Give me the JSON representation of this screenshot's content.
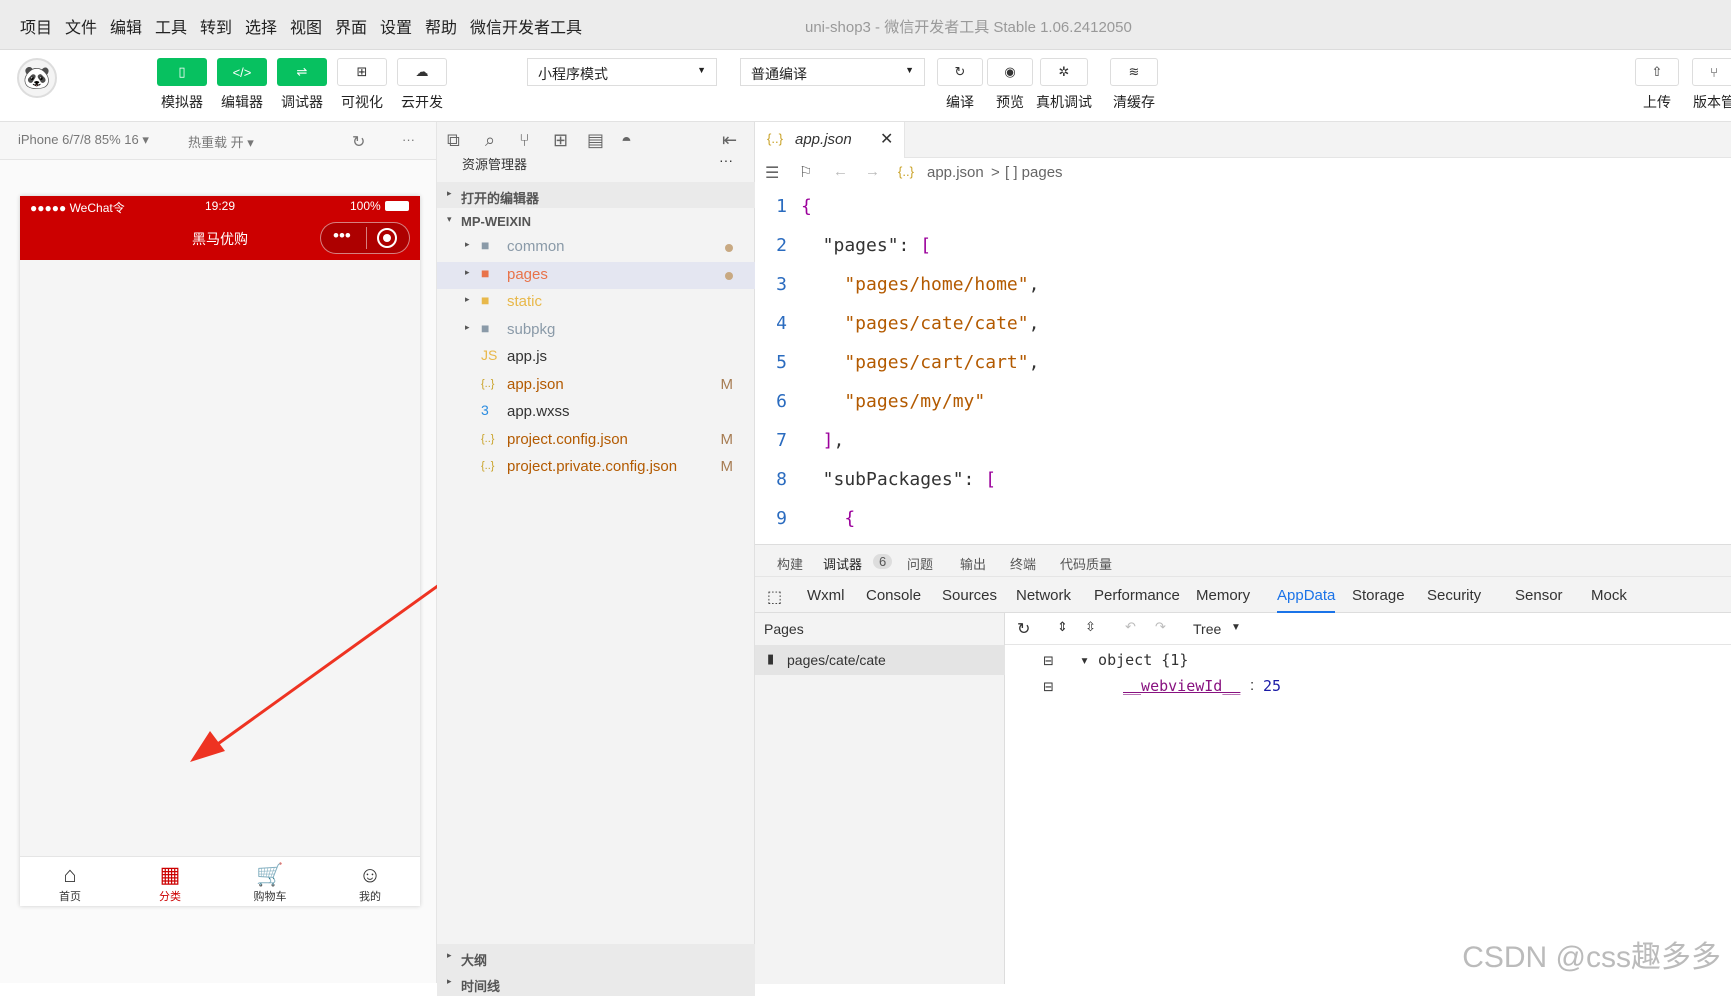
{
  "menubar": {
    "items": [
      "项目",
      "文件",
      "编辑",
      "工具",
      "转到",
      "选择",
      "视图",
      "界面",
      "设置",
      "帮助",
      "微信开发者工具"
    ],
    "title": "uni-shop3 - 微信开发者工具 Stable 1.06.2412050"
  },
  "toolbar": {
    "buttons": [
      {
        "label": "模拟器",
        "icon": "▯"
      },
      {
        "label": "编辑器",
        "icon": "</>"
      },
      {
        "label": "调试器",
        "icon": "⇌"
      },
      {
        "label": "可视化",
        "icon": "⊞"
      },
      {
        "label": "云开发",
        "icon": "☁"
      }
    ],
    "mode_select": "小程序模式",
    "compile_select": "普通编译",
    "actions": [
      {
        "label": "编译",
        "icon": "↻"
      },
      {
        "label": "预览",
        "icon": "◉"
      },
      {
        "label": "真机调试",
        "icon": "✲"
      },
      {
        "label": "清缓存",
        "icon": "≋"
      }
    ],
    "right": [
      {
        "label": "上传",
        "icon": "⇧"
      },
      {
        "label": "版本管",
        "icon": "⑂"
      }
    ]
  },
  "simulator": {
    "device": "iPhone 6/7/8 85% 16 ▾",
    "hotreload": "热重载 开 ▾",
    "status": {
      "carrier": "●●●●● WeChat令",
      "time": "19:29",
      "battery": "100%"
    },
    "nav_title": "黑马优购",
    "tabs": [
      {
        "label": "首页",
        "icon": "⌂"
      },
      {
        "label": "分类",
        "icon": "▦"
      },
      {
        "label": "购物车",
        "icon": "🛒"
      },
      {
        "label": "我的",
        "icon": "☺"
      }
    ],
    "active_tab": "分类"
  },
  "explorer": {
    "title": "资源管理器",
    "more": "···",
    "open_editors": "打开的编辑器",
    "project": "MP-WEIXIN",
    "items": [
      {
        "name": "common",
        "icon": "folder",
        "color": "#8a9aa8",
        "mark": "dot",
        "twisty": "▸"
      },
      {
        "name": "pages",
        "icon": "folder",
        "color": "#e8734a",
        "mark": "dot",
        "twisty": "▸"
      },
      {
        "name": "static",
        "icon": "folder",
        "color": "#e8b84a",
        "mark": "",
        "twisty": "▸"
      },
      {
        "name": "subpkg",
        "icon": "folder",
        "color": "#8a9aa8",
        "mark": "",
        "twisty": "▸"
      },
      {
        "name": "app.js",
        "icon": "js",
        "color": "#333",
        "mark": "",
        "twisty": ""
      },
      {
        "name": "app.json",
        "icon": "json",
        "color": "#b35a00",
        "mark": "M",
        "twisty": ""
      },
      {
        "name": "app.wxss",
        "icon": "css",
        "color": "#333",
        "mark": "",
        "twisty": ""
      },
      {
        "name": "project.config.json",
        "icon": "json",
        "color": "#b35a00",
        "mark": "M",
        "twisty": ""
      },
      {
        "name": "project.private.config.json",
        "icon": "json",
        "color": "#b35a00",
        "mark": "M",
        "twisty": ""
      }
    ],
    "outline": "大纲",
    "timeline": "时间线"
  },
  "editor": {
    "tab": "app.json",
    "crumb_file": "app.json",
    "crumb_sep": ">",
    "crumb_node": "[ ] pages",
    "lines": [
      {
        "n": "1",
        "parts": [
          [
            "b",
            "{"
          ]
        ]
      },
      {
        "n": "2",
        "parts": [
          [
            "k",
            "  \"pages\": "
          ],
          [
            "b",
            "["
          ]
        ]
      },
      {
        "n": "3",
        "parts": [
          [
            "s",
            "    \"pages/home/home\""
          ],
          [
            "k",
            ","
          ]
        ]
      },
      {
        "n": "4",
        "parts": [
          [
            "s",
            "    \"pages/cate/cate\""
          ],
          [
            "k",
            ","
          ]
        ]
      },
      {
        "n": "5",
        "parts": [
          [
            "s",
            "    \"pages/cart/cart\""
          ],
          [
            "k",
            ","
          ]
        ]
      },
      {
        "n": "6",
        "parts": [
          [
            "s",
            "    \"pages/my/my\""
          ]
        ]
      },
      {
        "n": "7",
        "parts": [
          [
            "b",
            "  ]"
          ],
          [
            "k",
            ","
          ]
        ]
      },
      {
        "n": "8",
        "parts": [
          [
            "k",
            "  \"subPackages\": "
          ],
          [
            "b",
            "["
          ]
        ]
      },
      {
        "n": "9",
        "parts": [
          [
            "b",
            "    {"
          ]
        ]
      }
    ]
  },
  "devtools": {
    "top_tabs": [
      "构建",
      "调试器",
      "6",
      "问题",
      "输出",
      "终端",
      "代码质量"
    ],
    "tabs": [
      "Wxml",
      "Console",
      "Sources",
      "Network",
      "Performance",
      "Memory",
      "AppData",
      "Storage",
      "Security",
      "Sensor",
      "Mock"
    ],
    "active": "AppData",
    "pages_title": "Pages",
    "page_item": "pages/cate/cate",
    "view": "Tree",
    "object_label": "▾ object {1}",
    "key": "__webviewId__",
    "colon": ":",
    "value": "25"
  },
  "watermark": "CSDN @css趣多多"
}
